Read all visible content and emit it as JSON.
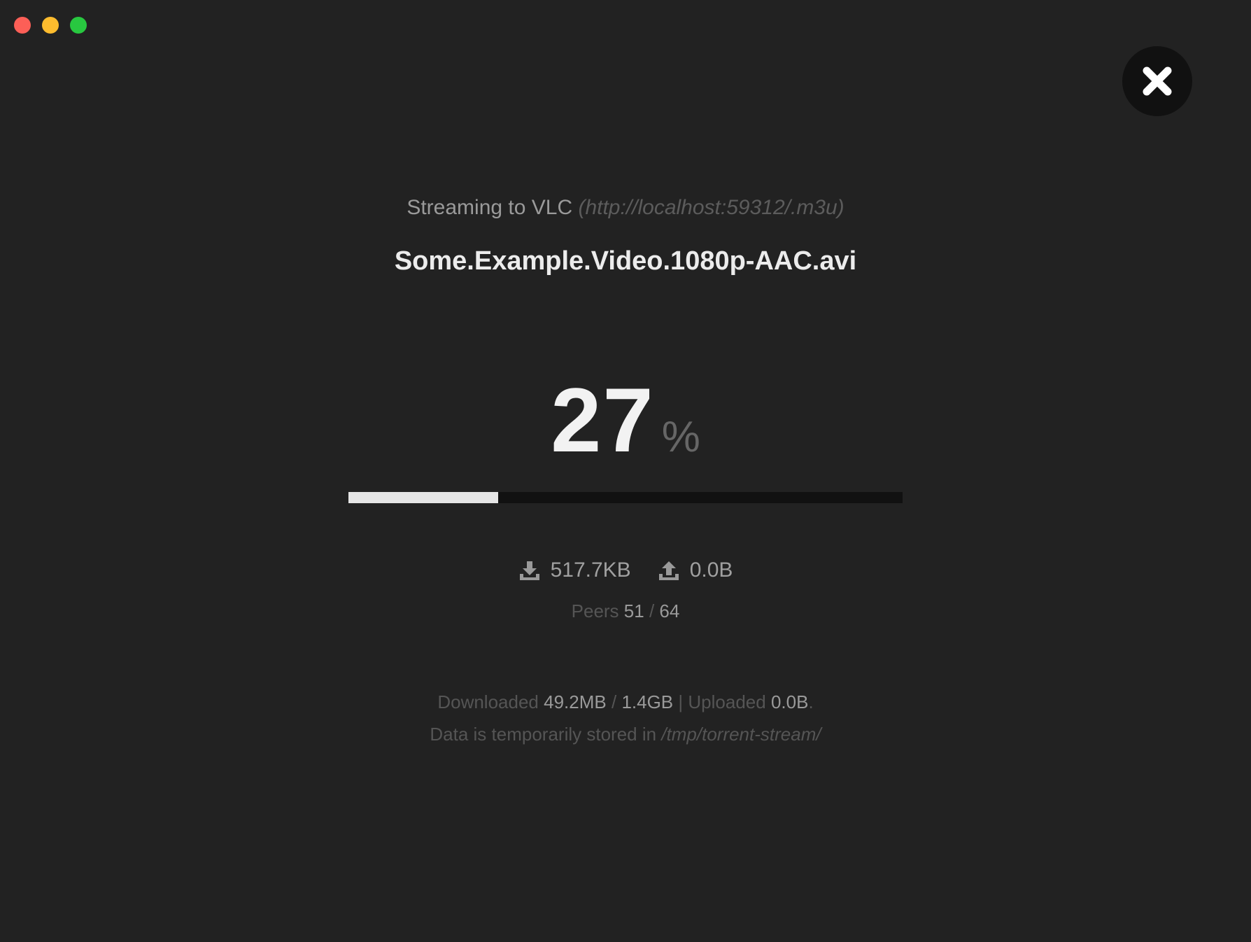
{
  "window": {
    "controls": [
      "close",
      "minimize",
      "maximize"
    ],
    "colors": {
      "close": "#fc5f57",
      "minimize": "#fdbc2e",
      "maximize": "#28c840"
    }
  },
  "close_button": {
    "icon": "close-x-icon"
  },
  "status": {
    "streaming_label": "Streaming to VLC",
    "stream_url": "(http://localhost:59312/.m3u)",
    "filename": "Some.Example.Video.1080p-AAC.avi"
  },
  "progress": {
    "percent_value": "27",
    "percent_sign": "%",
    "fraction": 0.27
  },
  "speeds": {
    "download_icon": "download-icon",
    "download_speed": "517.7KB",
    "upload_icon": "upload-icon",
    "upload_speed": "0.0B"
  },
  "peers": {
    "label": "Peers",
    "active": "51",
    "separator": "/",
    "total": "64"
  },
  "totals": {
    "downloaded_label": "Downloaded",
    "downloaded": "49.2MB",
    "separator": "/",
    "size": "1.4GB",
    "divider": "|",
    "uploaded_label": "Uploaded",
    "uploaded": "0.0B",
    "end": "."
  },
  "storage": {
    "label": "Data is temporarily stored in",
    "path": "/tmp/torrent-stream/"
  },
  "colors": {
    "background": "#222222",
    "progress_fill": "#e6e6e6",
    "progress_track": "#111111"
  }
}
